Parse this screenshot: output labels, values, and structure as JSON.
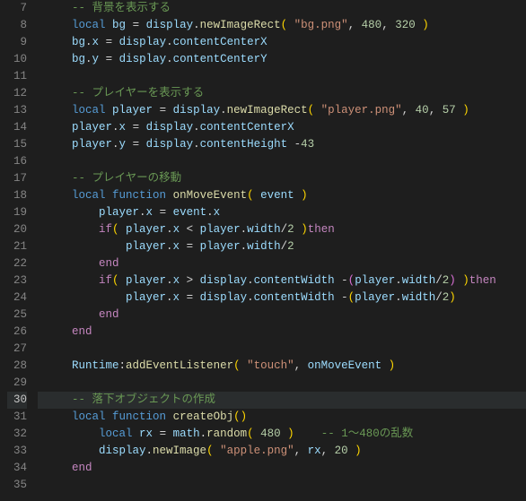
{
  "editor": {
    "highlighted_line": 30,
    "lines": [
      {
        "n": 7,
        "tokens": [
          {
            "t": "    ",
            "c": ""
          },
          {
            "t": "-- 背景を表示する",
            "c": "t-comment"
          }
        ]
      },
      {
        "n": 8,
        "tokens": [
          {
            "t": "    ",
            "c": ""
          },
          {
            "t": "local",
            "c": "t-keyword"
          },
          {
            "t": " ",
            "c": ""
          },
          {
            "t": "bg",
            "c": "t-ident"
          },
          {
            "t": " = ",
            "c": "t-op"
          },
          {
            "t": "display",
            "c": "t-ident"
          },
          {
            "t": ".",
            "c": "t-op"
          },
          {
            "t": "newImageRect",
            "c": "t-method"
          },
          {
            "t": "( ",
            "c": "t-paren"
          },
          {
            "t": "\"bg.png\"",
            "c": "t-string"
          },
          {
            "t": ", ",
            "c": "t-op"
          },
          {
            "t": "480",
            "c": "t-number"
          },
          {
            "t": ", ",
            "c": "t-op"
          },
          {
            "t": "320",
            "c": "t-number"
          },
          {
            "t": " )",
            "c": "t-paren"
          }
        ]
      },
      {
        "n": 9,
        "tokens": [
          {
            "t": "    ",
            "c": ""
          },
          {
            "t": "bg",
            "c": "t-ident"
          },
          {
            "t": ".",
            "c": "t-op"
          },
          {
            "t": "x",
            "c": "t-prop"
          },
          {
            "t": " = ",
            "c": "t-op"
          },
          {
            "t": "display",
            "c": "t-ident"
          },
          {
            "t": ".",
            "c": "t-op"
          },
          {
            "t": "contentCenterX",
            "c": "t-prop"
          }
        ]
      },
      {
        "n": 10,
        "tokens": [
          {
            "t": "    ",
            "c": ""
          },
          {
            "t": "bg",
            "c": "t-ident"
          },
          {
            "t": ".",
            "c": "t-op"
          },
          {
            "t": "y",
            "c": "t-prop"
          },
          {
            "t": " = ",
            "c": "t-op"
          },
          {
            "t": "display",
            "c": "t-ident"
          },
          {
            "t": ".",
            "c": "t-op"
          },
          {
            "t": "contentCenterY",
            "c": "t-prop"
          }
        ]
      },
      {
        "n": 11,
        "tokens": []
      },
      {
        "n": 12,
        "tokens": [
          {
            "t": "    ",
            "c": ""
          },
          {
            "t": "-- プレイヤーを表示する",
            "c": "t-comment"
          }
        ]
      },
      {
        "n": 13,
        "tokens": [
          {
            "t": "    ",
            "c": ""
          },
          {
            "t": "local",
            "c": "t-keyword"
          },
          {
            "t": " ",
            "c": ""
          },
          {
            "t": "player",
            "c": "t-ident"
          },
          {
            "t": " = ",
            "c": "t-op"
          },
          {
            "t": "display",
            "c": "t-ident"
          },
          {
            "t": ".",
            "c": "t-op"
          },
          {
            "t": "newImageRect",
            "c": "t-method"
          },
          {
            "t": "( ",
            "c": "t-paren"
          },
          {
            "t": "\"player.png\"",
            "c": "t-string"
          },
          {
            "t": ", ",
            "c": "t-op"
          },
          {
            "t": "40",
            "c": "t-number"
          },
          {
            "t": ", ",
            "c": "t-op"
          },
          {
            "t": "57",
            "c": "t-number"
          },
          {
            "t": " )",
            "c": "t-paren"
          }
        ]
      },
      {
        "n": 14,
        "tokens": [
          {
            "t": "    ",
            "c": ""
          },
          {
            "t": "player",
            "c": "t-ident"
          },
          {
            "t": ".",
            "c": "t-op"
          },
          {
            "t": "x",
            "c": "t-prop"
          },
          {
            "t": " = ",
            "c": "t-op"
          },
          {
            "t": "display",
            "c": "t-ident"
          },
          {
            "t": ".",
            "c": "t-op"
          },
          {
            "t": "contentCenterX",
            "c": "t-prop"
          }
        ]
      },
      {
        "n": 15,
        "tokens": [
          {
            "t": "    ",
            "c": ""
          },
          {
            "t": "player",
            "c": "t-ident"
          },
          {
            "t": ".",
            "c": "t-op"
          },
          {
            "t": "y",
            "c": "t-prop"
          },
          {
            "t": " = ",
            "c": "t-op"
          },
          {
            "t": "display",
            "c": "t-ident"
          },
          {
            "t": ".",
            "c": "t-op"
          },
          {
            "t": "contentHeight",
            "c": "t-prop"
          },
          {
            "t": " -",
            "c": "t-op"
          },
          {
            "t": "43",
            "c": "t-number"
          }
        ]
      },
      {
        "n": 16,
        "tokens": []
      },
      {
        "n": 17,
        "tokens": [
          {
            "t": "    ",
            "c": ""
          },
          {
            "t": "-- プレイヤーの移動",
            "c": "t-comment"
          }
        ]
      },
      {
        "n": 18,
        "tokens": [
          {
            "t": "    ",
            "c": ""
          },
          {
            "t": "local",
            "c": "t-keyword"
          },
          {
            "t": " ",
            "c": ""
          },
          {
            "t": "function",
            "c": "t-keyword"
          },
          {
            "t": " ",
            "c": ""
          },
          {
            "t": "onMoveEvent",
            "c": "t-func"
          },
          {
            "t": "( ",
            "c": "t-paren"
          },
          {
            "t": "event",
            "c": "t-ident"
          },
          {
            "t": " )",
            "c": "t-paren"
          }
        ]
      },
      {
        "n": 19,
        "tokens": [
          {
            "t": "        ",
            "c": ""
          },
          {
            "t": "player",
            "c": "t-ident"
          },
          {
            "t": ".",
            "c": "t-op"
          },
          {
            "t": "x",
            "c": "t-prop"
          },
          {
            "t": " = ",
            "c": "t-op"
          },
          {
            "t": "event",
            "c": "t-ident"
          },
          {
            "t": ".",
            "c": "t-op"
          },
          {
            "t": "x",
            "c": "t-prop"
          }
        ]
      },
      {
        "n": 20,
        "tokens": [
          {
            "t": "        ",
            "c": ""
          },
          {
            "t": "if",
            "c": "t-control"
          },
          {
            "t": "( ",
            "c": "t-paren"
          },
          {
            "t": "player",
            "c": "t-ident"
          },
          {
            "t": ".",
            "c": "t-op"
          },
          {
            "t": "x",
            "c": "t-prop"
          },
          {
            "t": " < ",
            "c": "t-op"
          },
          {
            "t": "player",
            "c": "t-ident"
          },
          {
            "t": ".",
            "c": "t-op"
          },
          {
            "t": "width",
            "c": "t-prop"
          },
          {
            "t": "/",
            "c": "t-op"
          },
          {
            "t": "2",
            "c": "t-number"
          },
          {
            "t": " )",
            "c": "t-paren"
          },
          {
            "t": "then",
            "c": "t-control"
          }
        ]
      },
      {
        "n": 21,
        "tokens": [
          {
            "t": "            ",
            "c": ""
          },
          {
            "t": "player",
            "c": "t-ident"
          },
          {
            "t": ".",
            "c": "t-op"
          },
          {
            "t": "x",
            "c": "t-prop"
          },
          {
            "t": " = ",
            "c": "t-op"
          },
          {
            "t": "player",
            "c": "t-ident"
          },
          {
            "t": ".",
            "c": "t-op"
          },
          {
            "t": "width",
            "c": "t-prop"
          },
          {
            "t": "/",
            "c": "t-op"
          },
          {
            "t": "2",
            "c": "t-number"
          }
        ]
      },
      {
        "n": 22,
        "tokens": [
          {
            "t": "        ",
            "c": ""
          },
          {
            "t": "end",
            "c": "t-control"
          }
        ]
      },
      {
        "n": 23,
        "tokens": [
          {
            "t": "        ",
            "c": ""
          },
          {
            "t": "if",
            "c": "t-control"
          },
          {
            "t": "( ",
            "c": "t-paren"
          },
          {
            "t": "player",
            "c": "t-ident"
          },
          {
            "t": ".",
            "c": "t-op"
          },
          {
            "t": "x",
            "c": "t-prop"
          },
          {
            "t": " > ",
            "c": "t-op"
          },
          {
            "t": "display",
            "c": "t-ident"
          },
          {
            "t": ".",
            "c": "t-op"
          },
          {
            "t": "contentWidth",
            "c": "t-prop"
          },
          {
            "t": " -",
            "c": "t-op"
          },
          {
            "t": "(",
            "c": "t-paren2"
          },
          {
            "t": "player",
            "c": "t-ident"
          },
          {
            "t": ".",
            "c": "t-op"
          },
          {
            "t": "width",
            "c": "t-prop"
          },
          {
            "t": "/",
            "c": "t-op"
          },
          {
            "t": "2",
            "c": "t-number"
          },
          {
            "t": ")",
            "c": "t-paren2"
          },
          {
            "t": " )",
            "c": "t-paren"
          },
          {
            "t": "then",
            "c": "t-control"
          }
        ]
      },
      {
        "n": 24,
        "tokens": [
          {
            "t": "            ",
            "c": ""
          },
          {
            "t": "player",
            "c": "t-ident"
          },
          {
            "t": ".",
            "c": "t-op"
          },
          {
            "t": "x",
            "c": "t-prop"
          },
          {
            "t": " = ",
            "c": "t-op"
          },
          {
            "t": "display",
            "c": "t-ident"
          },
          {
            "t": ".",
            "c": "t-op"
          },
          {
            "t": "contentWidth",
            "c": "t-prop"
          },
          {
            "t": " -",
            "c": "t-op"
          },
          {
            "t": "(",
            "c": "t-paren"
          },
          {
            "t": "player",
            "c": "t-ident"
          },
          {
            "t": ".",
            "c": "t-op"
          },
          {
            "t": "width",
            "c": "t-prop"
          },
          {
            "t": "/",
            "c": "t-op"
          },
          {
            "t": "2",
            "c": "t-number"
          },
          {
            "t": ")",
            "c": "t-paren"
          }
        ]
      },
      {
        "n": 25,
        "tokens": [
          {
            "t": "        ",
            "c": ""
          },
          {
            "t": "end",
            "c": "t-control"
          }
        ]
      },
      {
        "n": 26,
        "tokens": [
          {
            "t": "    ",
            "c": ""
          },
          {
            "t": "end",
            "c": "t-control"
          }
        ]
      },
      {
        "n": 27,
        "tokens": []
      },
      {
        "n": 28,
        "tokens": [
          {
            "t": "    ",
            "c": ""
          },
          {
            "t": "Runtime",
            "c": "t-ident"
          },
          {
            "t": ":",
            "c": "t-op"
          },
          {
            "t": "addEventListener",
            "c": "t-method"
          },
          {
            "t": "( ",
            "c": "t-paren"
          },
          {
            "t": "\"touch\"",
            "c": "t-string"
          },
          {
            "t": ", ",
            "c": "t-op"
          },
          {
            "t": "onMoveEvent",
            "c": "t-ident"
          },
          {
            "t": " )",
            "c": "t-paren"
          }
        ]
      },
      {
        "n": 29,
        "tokens": []
      },
      {
        "n": 30,
        "tokens": [
          {
            "t": "    ",
            "c": ""
          },
          {
            "t": "-- 落下オブジェクトの作成",
            "c": "t-comment"
          }
        ]
      },
      {
        "n": 31,
        "tokens": [
          {
            "t": "    ",
            "c": ""
          },
          {
            "t": "local",
            "c": "t-keyword"
          },
          {
            "t": " ",
            "c": ""
          },
          {
            "t": "function",
            "c": "t-keyword"
          },
          {
            "t": " ",
            "c": ""
          },
          {
            "t": "createObj",
            "c": "t-func"
          },
          {
            "t": "()",
            "c": "t-paren"
          }
        ]
      },
      {
        "n": 32,
        "tokens": [
          {
            "t": "        ",
            "c": ""
          },
          {
            "t": "local",
            "c": "t-keyword"
          },
          {
            "t": " ",
            "c": ""
          },
          {
            "t": "rx",
            "c": "t-ident"
          },
          {
            "t": " = ",
            "c": "t-op"
          },
          {
            "t": "math",
            "c": "t-ident"
          },
          {
            "t": ".",
            "c": "t-op"
          },
          {
            "t": "random",
            "c": "t-method"
          },
          {
            "t": "( ",
            "c": "t-paren"
          },
          {
            "t": "480",
            "c": "t-number"
          },
          {
            "t": " )",
            "c": "t-paren"
          },
          {
            "t": "    ",
            "c": ""
          },
          {
            "t": "-- 1～480の乱数",
            "c": "t-comment"
          }
        ]
      },
      {
        "n": 33,
        "tokens": [
          {
            "t": "        ",
            "c": ""
          },
          {
            "t": "display",
            "c": "t-ident"
          },
          {
            "t": ".",
            "c": "t-op"
          },
          {
            "t": "newImage",
            "c": "t-method"
          },
          {
            "t": "( ",
            "c": "t-paren"
          },
          {
            "t": "\"apple.png\"",
            "c": "t-string"
          },
          {
            "t": ", ",
            "c": "t-op"
          },
          {
            "t": "rx",
            "c": "t-ident"
          },
          {
            "t": ", ",
            "c": "t-op"
          },
          {
            "t": "20",
            "c": "t-number"
          },
          {
            "t": " )",
            "c": "t-paren"
          }
        ]
      },
      {
        "n": 34,
        "tokens": [
          {
            "t": "    ",
            "c": ""
          },
          {
            "t": "end",
            "c": "t-control"
          }
        ]
      },
      {
        "n": 35,
        "tokens": []
      }
    ]
  }
}
